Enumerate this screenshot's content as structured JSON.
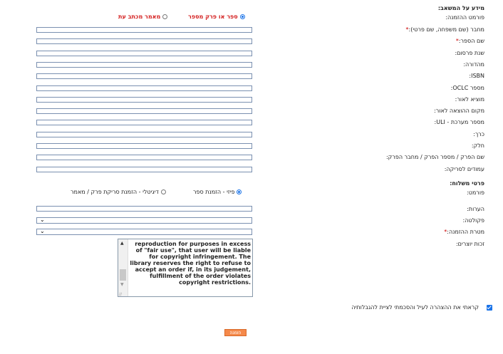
{
  "sections": {
    "order_info": "מידע על המשאב:",
    "delivery": "פרטי משלוח:"
  },
  "order_format": {
    "label": "פורמט ההזמנה:",
    "options": [
      {
        "label": "ספר או פרק מספר",
        "selected": true
      },
      {
        "label": "מאמר מכתב עת",
        "selected": false
      }
    ]
  },
  "fields": [
    {
      "label": "מחבר (שם משפחה, שם פרטי):",
      "required": true
    },
    {
      "label": "שם הספר:",
      "required": true
    },
    {
      "label": "שנת פרסום:",
      "required": false
    },
    {
      "label": "מהדורה:",
      "required": false
    },
    {
      "label": "ISBN:",
      "required": false
    },
    {
      "label": "מספר OCLC:",
      "required": false
    },
    {
      "label": "מוציא לאור:",
      "required": false
    },
    {
      "label": "מקום ההוצאה לאור:",
      "required": false
    },
    {
      "label": "מספר מערכת - ULI:",
      "required": false
    },
    {
      "label": "כרך:",
      "required": false
    },
    {
      "label": "חלק:",
      "required": false
    },
    {
      "label": "שם הפרק / מספר הפרק / מחבר הפרק:",
      "required": false
    },
    {
      "label": "עמודים לסריקה:",
      "required": false
    }
  ],
  "format": {
    "label": "פורמט:",
    "options": [
      {
        "label": "פיזי - הזמנת ספר",
        "selected": true
      },
      {
        "label": "דיגיטלי - הזמנת סריקת פרק / מאמר",
        "selected": false
      }
    ]
  },
  "notes": {
    "label": "הערות:"
  },
  "faculty": {
    "label": "פקולטה:",
    "value": ""
  },
  "purpose": {
    "label": "מטרת ההזמנה:",
    "value": ""
  },
  "copyright": {
    "label": "זכות יוצרים:",
    "text": "reproduction for purposes in excess of \"fair use\", that user will be liable for copyright infringement. The library reserves the right to refuse to accept an order if, in its judgement, fulfillment of the order violates copyright restrictions."
  },
  "agreement": {
    "label": "קראתי את ההצהרה לעיל והסכמתי לציית להגבלותיה",
    "checked": true
  },
  "submit_label": "הזמנה",
  "colors": {
    "required": "#cc0000",
    "accent": "#1a73e8",
    "submit": "#f5894a"
  }
}
